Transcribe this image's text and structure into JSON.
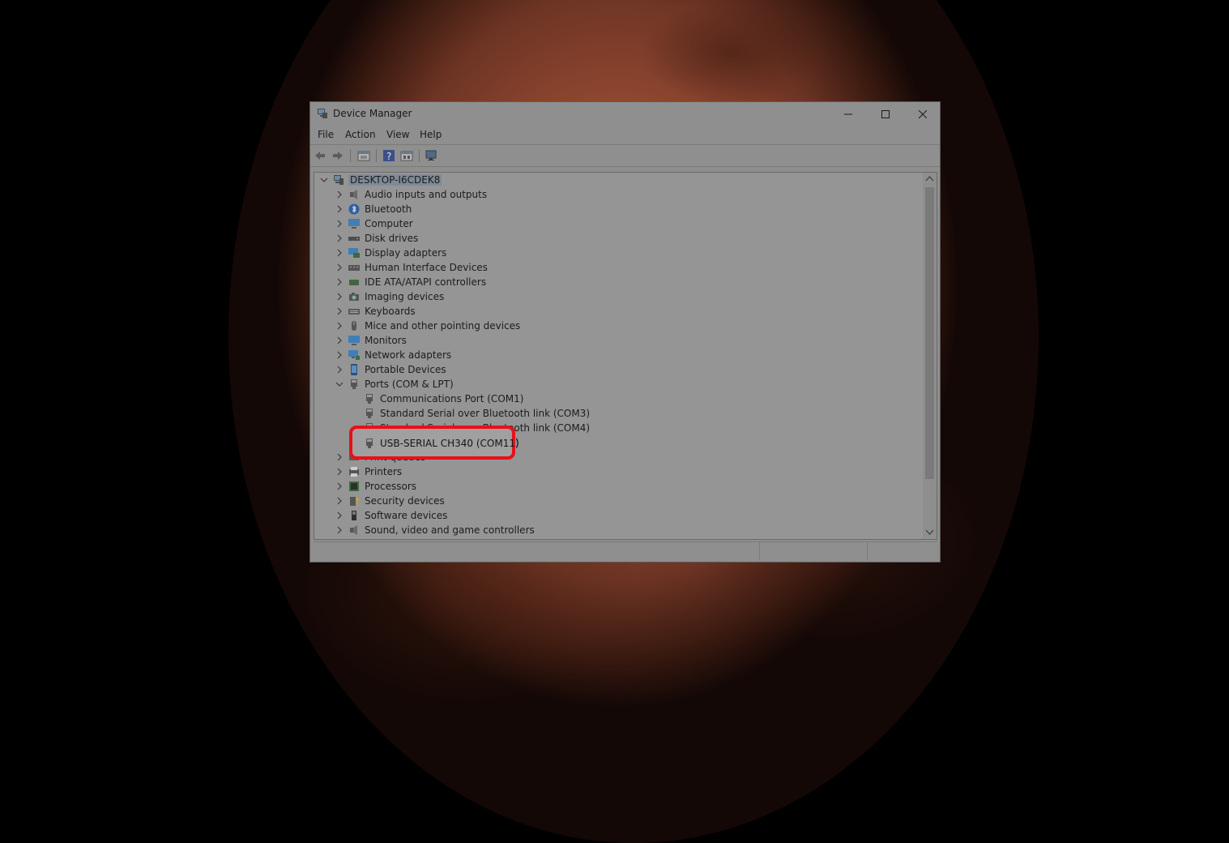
{
  "window": {
    "title": "Device Manager",
    "controls": {
      "minimize": "minimize",
      "maximize": "maximize",
      "close": "close"
    }
  },
  "menu": [
    "File",
    "Action",
    "View",
    "Help"
  ],
  "toolbar": [
    "back-icon",
    "forward-icon",
    "properties-icon",
    "help-icon",
    "update-driver-icon",
    "scan-hardware-icon"
  ],
  "tree": {
    "root": "DESKTOP-I6CDEK8",
    "categories": [
      "Audio inputs and outputs",
      "Bluetooth",
      "Computer",
      "Disk drives",
      "Display adapters",
      "Human Interface Devices",
      "IDE ATA/ATAPI controllers",
      "Imaging devices",
      "Keyboards",
      "Mice and other pointing devices",
      "Monitors",
      "Network adapters",
      "Portable Devices"
    ],
    "ports": {
      "label": "Ports (COM & LPT)",
      "children": [
        "Communications Port (COM1)",
        "Standard Serial over Bluetooth link (COM3)",
        "Standard Serial over Bluetooth link (COM4)",
        "USB-SERIAL CH340 (COM11)"
      ]
    },
    "after": [
      "Print queues",
      "Printers",
      "Processors",
      "Security devices",
      "Software devices",
      "Sound, video and game controllers"
    ]
  },
  "highlighted_item": "USB-SERIAL CH340 (COM11)",
  "colors": {
    "highlight_border": "#e8101a"
  }
}
